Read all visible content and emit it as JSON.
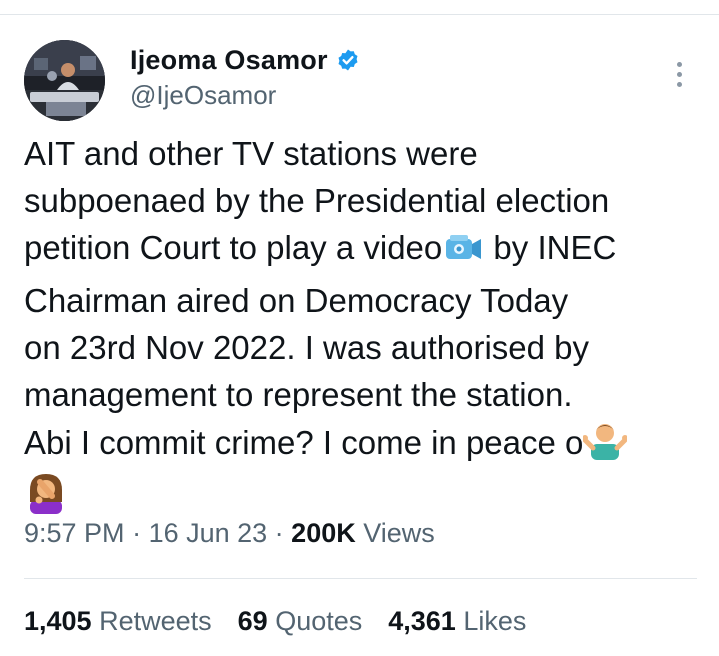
{
  "author": {
    "display_name": "Ijeoma Osamor",
    "handle": "@IjeOsamor",
    "verified_icon": "verified-badge-icon"
  },
  "tweet": {
    "lines": [
      "AIT and other TV stations were",
      "subpoenaed by the Presidential election",
      "petition Court to play a video",
      " by INEC",
      "Chairman aired on Democracy Today",
      "on 23rd Nov 2022. I was authorised by",
      "management to represent the station.",
      "Abi I commit crime? I come in peace o"
    ],
    "emojis": [
      "video-camera-emoji",
      "shrug-emoji",
      "facepalm-emoji"
    ]
  },
  "meta": {
    "time": "9:57 PM",
    "sep1": " · ",
    "date": "16 Jun 23",
    "sep2": " · ",
    "views_count": "200K",
    "views_label": " Views"
  },
  "stats": {
    "retweets_count": "1,405",
    "retweets_label": " Retweets",
    "quotes_count": "69",
    "quotes_label": " Quotes",
    "likes_count": "4,361",
    "likes_label": " Likes"
  },
  "colors": {
    "text": "#0f1419",
    "secondary": "#536471",
    "verified": "#1d9bf0",
    "divider": "#e1e6ea"
  }
}
